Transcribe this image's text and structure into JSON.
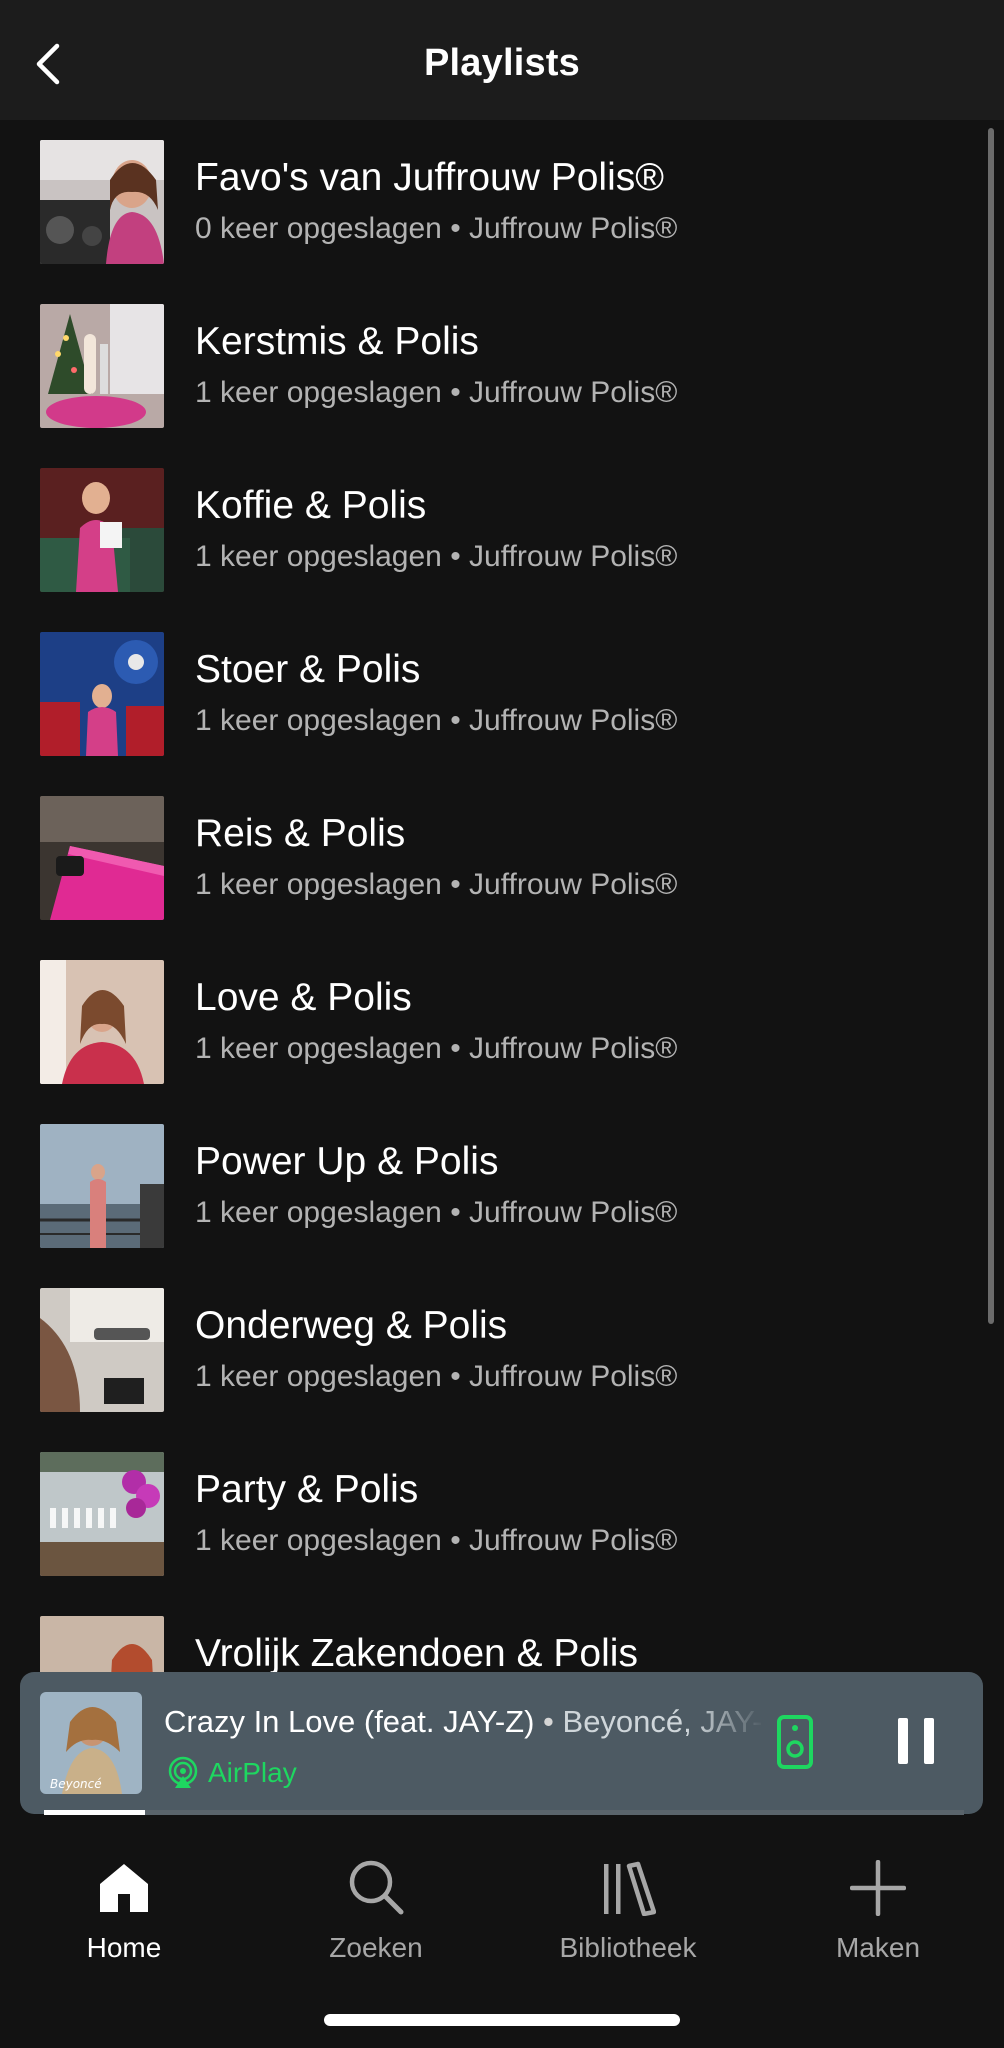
{
  "header": {
    "title": "Playlists"
  },
  "playlists": [
    {
      "title": "Favo's van Juffrouw Polis®",
      "subtitle": "0 keer opgeslagen • Juffrouw Polis®"
    },
    {
      "title": "Kerstmis & Polis",
      "subtitle": "1 keer opgeslagen • Juffrouw Polis®"
    },
    {
      "title": "Koffie & Polis",
      "subtitle": "1 keer opgeslagen • Juffrouw Polis®"
    },
    {
      "title": "Stoer & Polis",
      "subtitle": "1 keer opgeslagen • Juffrouw Polis®"
    },
    {
      "title": "Reis & Polis",
      "subtitle": "1 keer opgeslagen • Juffrouw Polis®"
    },
    {
      "title": "Love & Polis",
      "subtitle": "1 keer opgeslagen • Juffrouw Polis®"
    },
    {
      "title": "Power Up & Polis",
      "subtitle": "1 keer opgeslagen • Juffrouw Polis®"
    },
    {
      "title": "Onderweg & Polis",
      "subtitle": "1 keer opgeslagen • Juffrouw Polis®"
    },
    {
      "title": "Party & Polis",
      "subtitle": "1 keer opgeslagen • Juffrouw Polis®"
    },
    {
      "title": "Vrolijk Zakendoen & Polis",
      "subtitle": ""
    }
  ],
  "now_playing": {
    "track": "Crazy In Love (feat. JAY-Z)",
    "separator": " • ",
    "artist": "Beyoncé, JAY-Z",
    "device": "AirPlay",
    "album_art_text": "Beyoncé",
    "progress": 0.11
  },
  "nav": [
    {
      "label": "Home",
      "icon": "home-icon",
      "active": true
    },
    {
      "label": "Zoeken",
      "icon": "search-icon",
      "active": false
    },
    {
      "label": "Bibliotheek",
      "icon": "library-icon",
      "active": false
    },
    {
      "label": "Maken",
      "icon": "plus-icon",
      "active": false
    }
  ],
  "colors": {
    "accent": "#1ed760",
    "background": "#121212",
    "player": "#4d5a63"
  }
}
